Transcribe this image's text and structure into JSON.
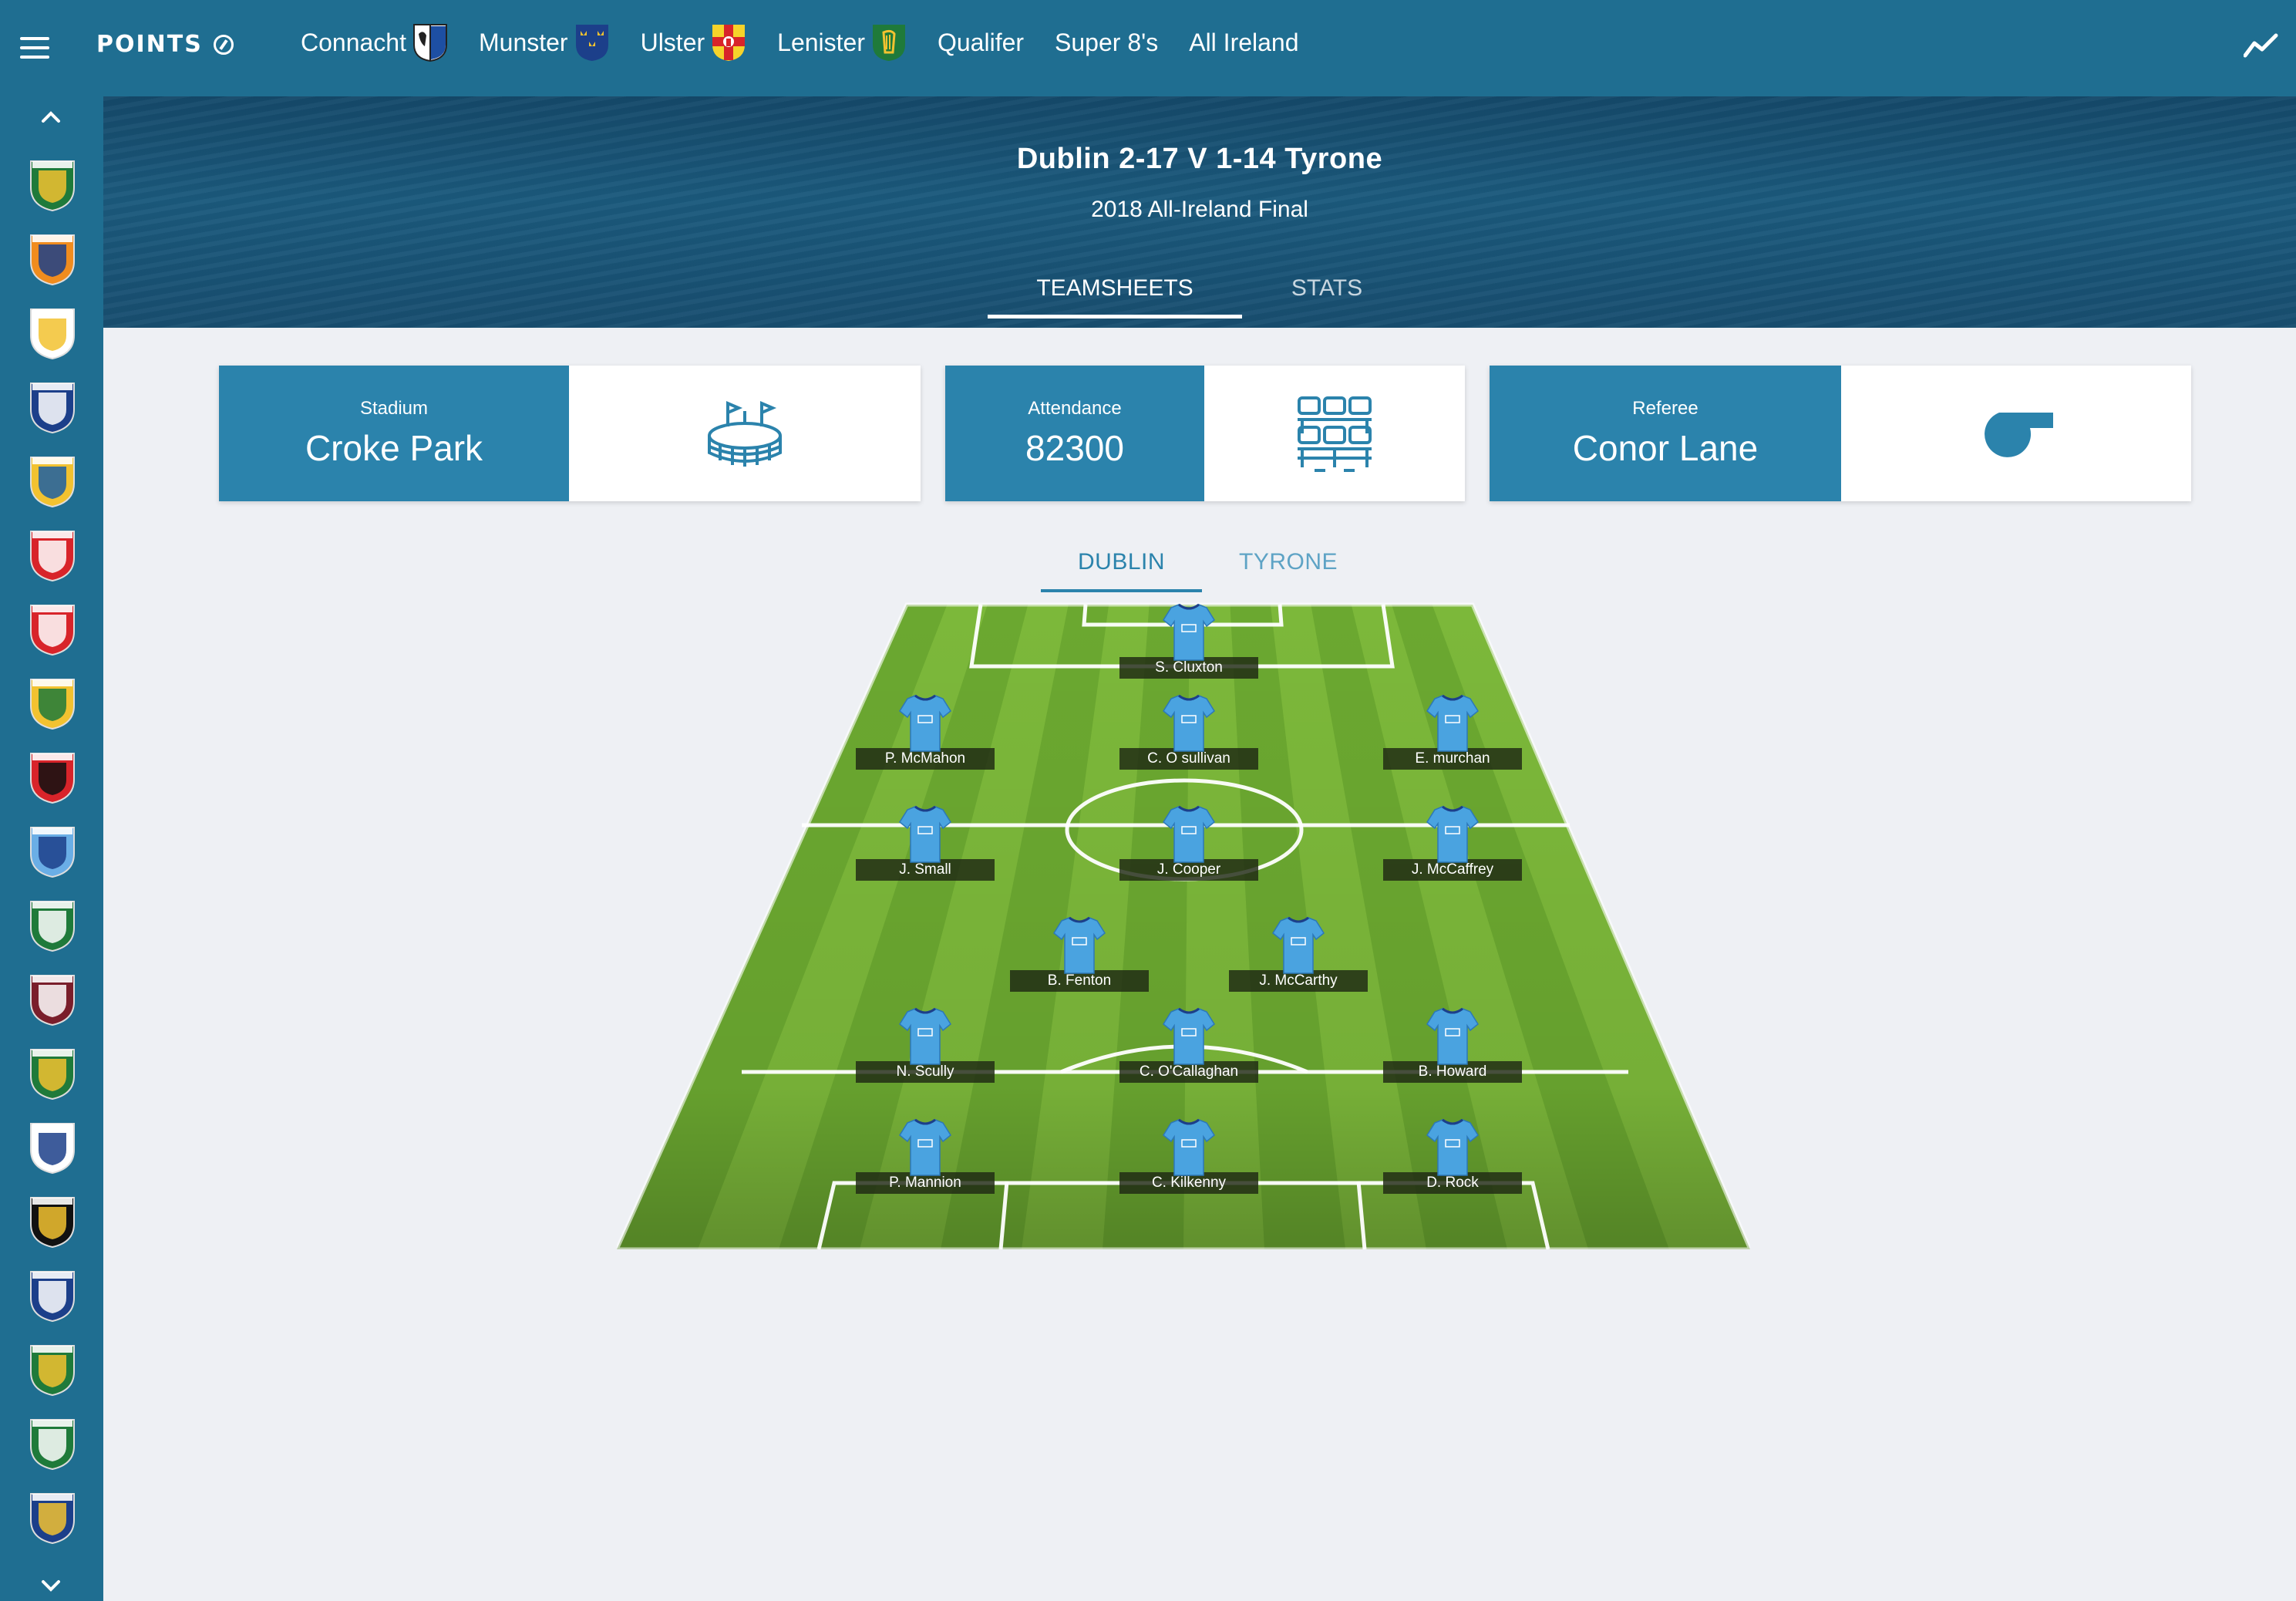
{
  "topbar": {
    "brand": "POINTS",
    "nav": [
      {
        "label": "Connacht",
        "crest": "connacht-crest-icon"
      },
      {
        "label": "Munster",
        "crest": "munster-crest-icon"
      },
      {
        "label": "Ulster",
        "crest": "ulster-crest-icon"
      },
      {
        "label": "Lenister",
        "crest": "leinster-crest-icon"
      },
      {
        "label": "Qualifer"
      },
      {
        "label": "Super 8's"
      },
      {
        "label": "All Ireland"
      }
    ],
    "stats_icon": "trend-line-icon"
  },
  "sidebar": {
    "county_crests": [
      "antrim",
      "armagh",
      "carlow",
      "cavan",
      "clare",
      "cork",
      "derry",
      "donegal",
      "down",
      "dublin",
      "fermanagh",
      "galway",
      "kerry",
      "kildare",
      "kilkenny",
      "laois",
      "leitrim",
      "limerick",
      "longford"
    ]
  },
  "match": {
    "title": "Dublin 2-17 V 1-14 Tyrone",
    "subtitle": "2018 All-Ireland Final",
    "tabs": [
      "TEAMSHEETS",
      "STATS"
    ],
    "active_tab": "TEAMSHEETS"
  },
  "info": {
    "stadium_label": "Stadium",
    "stadium_value": "Croke Park",
    "attendance_label": "Attendance",
    "attendance_value": "82300",
    "referee_label": "Referee",
    "referee_value": "Conor Lane"
  },
  "teams": {
    "tabs": [
      "DUBLIN",
      "TYRONE"
    ],
    "active": "DUBLIN"
  },
  "lineup": [
    {
      "name": "S. Cluxton",
      "row": 0,
      "col": 1
    },
    {
      "name": "P. McMahon",
      "row": 1,
      "col": 0
    },
    {
      "name": "C. O sullivan",
      "row": 1,
      "col": 1
    },
    {
      "name": "E. murchan",
      "row": 1,
      "col": 2
    },
    {
      "name": "J. Small",
      "row": 2,
      "col": 0
    },
    {
      "name": "J. Cooper",
      "row": 2,
      "col": 1
    },
    {
      "name": "J. McCaffrey",
      "row": 2,
      "col": 2
    },
    {
      "name": "B. Fenton",
      "row": 3,
      "col": 0.5
    },
    {
      "name": "J. McCarthy",
      "row": 3,
      "col": 1.5
    },
    {
      "name": "N. Scully",
      "row": 4,
      "col": 0
    },
    {
      "name": "C. O'Callaghan",
      "row": 4,
      "col": 1
    },
    {
      "name": "B. Howard",
      "row": 4,
      "col": 2
    },
    {
      "name": "P. Mannion",
      "row": 5,
      "col": 0
    },
    {
      "name": "C. Kilkenny",
      "row": 5,
      "col": 1
    },
    {
      "name": "D. Rock",
      "row": 5,
      "col": 2
    }
  ],
  "colors": {
    "primary": "#1f6e91",
    "accent": "#2b83ac",
    "pitch_light": "#7cb83a",
    "pitch_dark": "#5c9a28",
    "jersey": "#4aa3e0"
  }
}
